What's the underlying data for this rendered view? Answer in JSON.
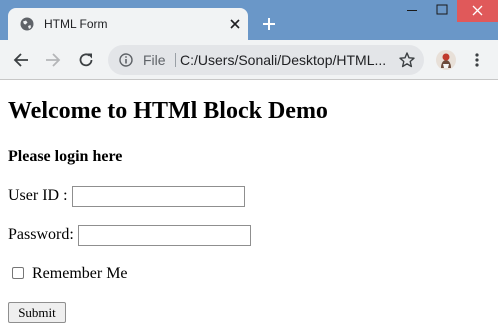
{
  "browser": {
    "tab": {
      "title": "HTML Form",
      "icon": "globe-icon",
      "close_icon": "close-icon"
    },
    "new_tab_icon": "plus-icon",
    "window_controls": [
      "minimize-icon",
      "maximize-icon",
      "close-icon"
    ],
    "toolbar": {
      "back_icon": "arrow-left-icon",
      "forward_icon": "arrow-right-icon",
      "reload_icon": "reload-icon",
      "address": {
        "info_icon": "info-icon",
        "scheme_label": "File",
        "url": "C:/Users/Sonali/Desktop/HTML...",
        "bookmark_icon": "star-icon"
      },
      "profile_icon": "avatar",
      "menu_icon": "kebab-menu-icon"
    },
    "colors": {
      "titlebar": "#6a97c8",
      "tab_background": "#f1f3f4",
      "close_button": "#e0595a"
    }
  },
  "page": {
    "heading": "Welcome to HTMl Block Demo",
    "login_prompt": "Please login here",
    "form": {
      "userid_label": "User ID :",
      "userid_value": "",
      "password_label": "Password:",
      "password_value": "",
      "remember_label": "Remember Me",
      "remember_checked": false,
      "submit_label": "Submit"
    }
  }
}
